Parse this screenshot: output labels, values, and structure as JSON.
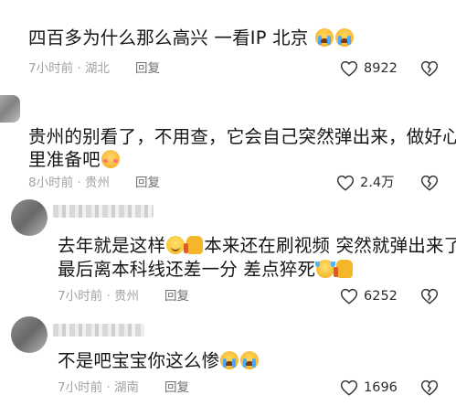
{
  "comments": [
    {
      "text": "四百多为什么那么高兴 一看IP 北京",
      "time": "7小时前",
      "location": "湖北",
      "reply_label": "回复",
      "likes": "8922",
      "emojis": [
        "loudly-crying-face",
        "loudly-crying-face"
      ]
    },
    {
      "text_line1": "贵州的别看了，不用查，它会自己突然弹出来，做好心",
      "text_line2": "里准备吧",
      "time": "8小时前",
      "location": "贵州",
      "reply_label": "回复",
      "likes": "2.4万",
      "emojis": [
        "blushing-face"
      ]
    },
    {
      "text_part1": "去年就是这样",
      "text_part2": "本来还在刷视频 突然就弹出来了",
      "text_line2": "最后离本科线还差一分 差点猝死",
      "time": "7小时前",
      "location": "贵州",
      "reply_label": "回复",
      "likes": "6252",
      "emojis": [
        "smiling-face",
        "thumbs-up",
        "laughing-crying-face",
        "thumbs-up"
      ]
    },
    {
      "text": "不是吧宝宝你这么惨",
      "time": "7小时前",
      "location": "湖南",
      "reply_label": "回复",
      "likes": "1696",
      "emojis": [
        "loudly-crying-face",
        "loudly-crying-face"
      ]
    }
  ],
  "meta_separator": "·",
  "colors": {
    "text": "#161616",
    "meta": "#a2a2a2",
    "reply": "#6f6f6f",
    "icon": "#333333"
  },
  "icons": {
    "like": "heart-outline-icon",
    "dislike": "broken-heart-outline-icon"
  }
}
